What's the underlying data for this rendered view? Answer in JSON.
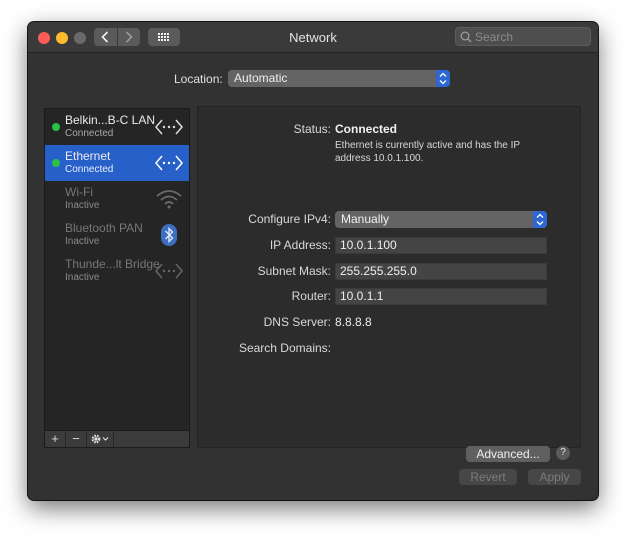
{
  "window": {
    "title": "Network",
    "search_placeholder": "Search"
  },
  "location": {
    "label": "Location:",
    "value": "Automatic"
  },
  "services": [
    {
      "name": "Belkin...B-C LAN",
      "status": "Connected",
      "state": "connected",
      "icon": "ethernet-arrows-icon"
    },
    {
      "name": "Ethernet",
      "status": "Connected",
      "state": "connected",
      "icon": "ethernet-arrows-icon"
    },
    {
      "name": "Wi-Fi",
      "status": "Inactive",
      "state": "inactive",
      "icon": "wifi-icon"
    },
    {
      "name": "Bluetooth PAN",
      "status": "Inactive",
      "state": "inactive",
      "icon": "bluetooth-icon"
    },
    {
      "name": "Thunde...lt Bridge",
      "status": "Inactive",
      "state": "inactive",
      "icon": "ethernet-arrows-icon"
    }
  ],
  "sidebar_toolbar": {
    "add": "+",
    "remove": "−"
  },
  "details": {
    "status_label": "Status:",
    "status_value": "Connected",
    "status_description": "Ethernet is currently active and has the IP address 10.0.1.100.",
    "configure_label": "Configure IPv4:",
    "configure_value": "Manually",
    "ip_label": "IP Address:",
    "ip_value": "10.0.1.100",
    "subnet_label": "Subnet Mask:",
    "subnet_value": "255.255.255.0",
    "router_label": "Router:",
    "router_value": "10.0.1.1",
    "dns_label": "DNS Server:",
    "dns_value": "8.8.8.8",
    "search_domains_label": "Search Domains:",
    "advanced_label": "Advanced...",
    "help_label": "?"
  },
  "footer": {
    "revert_label": "Revert",
    "apply_label": "Apply"
  },
  "colors": {
    "selection": "#2860c9",
    "connected_dot": "#2bc048",
    "close": "#fd5d56",
    "minimize": "#fdbb2e"
  }
}
